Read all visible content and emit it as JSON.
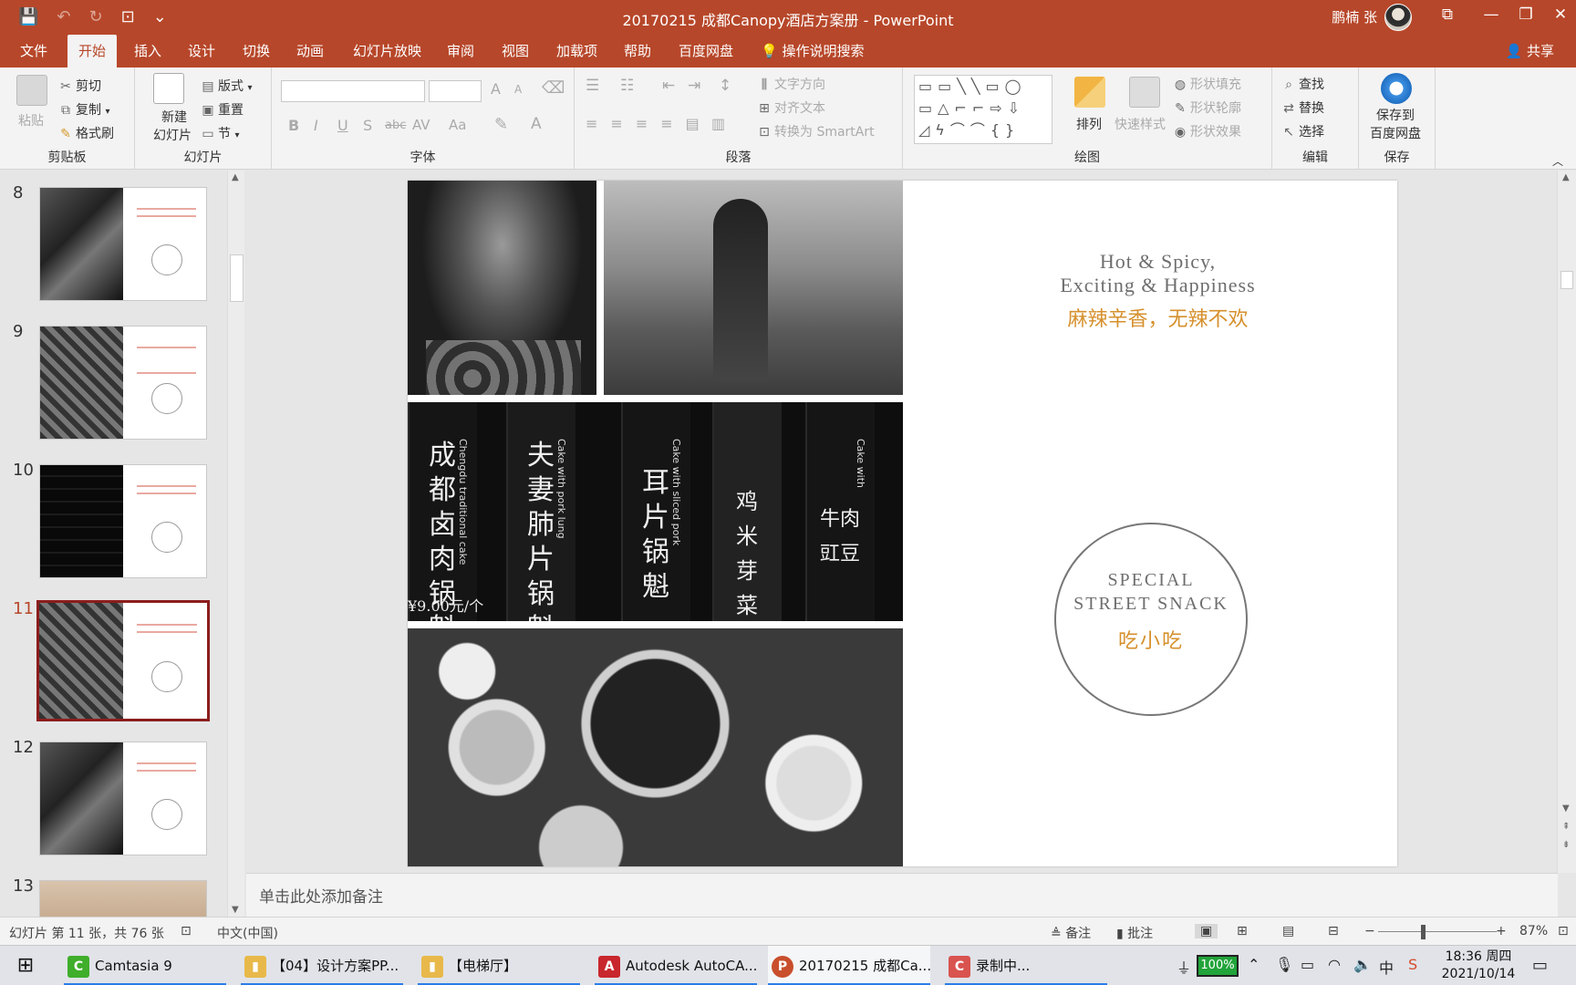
{
  "app": {
    "window_title": "20170215 成都Canopy酒店方案册  -  PowerPoint",
    "user_name": "鹏楠 张"
  },
  "qat": {
    "save": "💾",
    "undo": "↶",
    "redo": "↻",
    "present": "⊡",
    "more": "⌄"
  },
  "window_controls": {
    "ribbon_display": "⧉",
    "minimize": "—",
    "restore": "❐",
    "close": "✕"
  },
  "tabs": [
    {
      "label": "文件"
    },
    {
      "label": "开始"
    },
    {
      "label": "插入"
    },
    {
      "label": "设计"
    },
    {
      "label": "切换"
    },
    {
      "label": "动画"
    },
    {
      "label": "幻灯片放映"
    },
    {
      "label": "审阅"
    },
    {
      "label": "视图"
    },
    {
      "label": "加载项"
    },
    {
      "label": "帮助"
    },
    {
      "label": "百度网盘"
    }
  ],
  "tell_me": "操作说明搜索",
  "share": "共享",
  "ribbon": {
    "clipboard": {
      "paste": "粘贴",
      "cut": "剪切",
      "copy": "复制",
      "format_painter": "格式刷",
      "label": "剪贴板"
    },
    "slides": {
      "new_slide_1": "新建",
      "new_slide_2": "幻灯片",
      "layout": "版式",
      "reset": "重置",
      "section": "节",
      "label": "幻灯片"
    },
    "font": {
      "label": "字体",
      "bold": "B",
      "italic": "I",
      "underline": "U",
      "shadow": "S",
      "strike": "abc",
      "spacing": "AV",
      "case": "Aa",
      "color": "A",
      "grow": "A",
      "shrink": "A"
    },
    "paragraph": {
      "label": "段落",
      "text_direction": "文字方向",
      "align_text": "对齐文本",
      "smartart": "转换为 SmartArt"
    },
    "drawing": {
      "label": "绘图",
      "arrange": "排列",
      "quick_styles": "快速样式",
      "shape_fill": "形状填充",
      "shape_outline": "形状轮廓",
      "shape_effects": "形状效果"
    },
    "editing": {
      "label": "编辑",
      "find": "查找",
      "replace": "替换",
      "select": "选择"
    },
    "save": {
      "label": "保存",
      "save_to_1": "保存到",
      "save_to_2": "百度网盘"
    }
  },
  "thumbnails": [
    {
      "num": "8"
    },
    {
      "num": "9"
    },
    {
      "num": "10"
    },
    {
      "num": "11"
    },
    {
      "num": "12"
    },
    {
      "num": "13"
    }
  ],
  "slide": {
    "heading_line1": "Hot & Spicy,",
    "heading_line2": "Exciting & Happiness",
    "heading_cn": "麻辣辛香，无辣不欢",
    "circle_line1": "SPECIAL",
    "circle_line2": "STREET   SNACK",
    "circle_cn": "吃小吃",
    "signs": [
      {
        "chars": "成都卤肉锅魁",
        "en": "Chengdu traditional cake"
      },
      {
        "chars": "夫妻肺片锅魁",
        "en": "Cake with pork lung"
      },
      {
        "chars": "耳片锅魁",
        "en": "Cake with sliced pork"
      },
      {
        "chars": "鸡米芽菜",
        "en": ""
      },
      {
        "chars": "牛肉豇豆",
        "en": "Cake with"
      }
    ],
    "price": "¥9.00元/个"
  },
  "notes_placeholder": "单击此处添加备注",
  "status": {
    "slide_count": "幻灯片 第 11 张，共 76 张",
    "language": "中文(中国)",
    "notes": "备注",
    "comments": "批注",
    "zoom": "87%"
  },
  "taskbar": {
    "items": [
      {
        "label": "Camtasia 9",
        "badge": "C",
        "color": "#3fae2a"
      },
      {
        "label": "【04】设计方案PP...",
        "badge": "▮",
        "color": "#e8b94a"
      },
      {
        "label": "【电梯厅】",
        "badge": "▮",
        "color": "#e8b94a"
      },
      {
        "label": "Autodesk AutoCA...",
        "badge": "A",
        "color": "#c8272d"
      },
      {
        "label": "20170215 成都Ca...",
        "badge": "P",
        "color": "#c94f2c"
      },
      {
        "label": "录制中...",
        "badge": "C",
        "color": "#d9534f"
      }
    ],
    "battery": "100%",
    "time": "18:36 周四",
    "date": "2021/10/14"
  }
}
